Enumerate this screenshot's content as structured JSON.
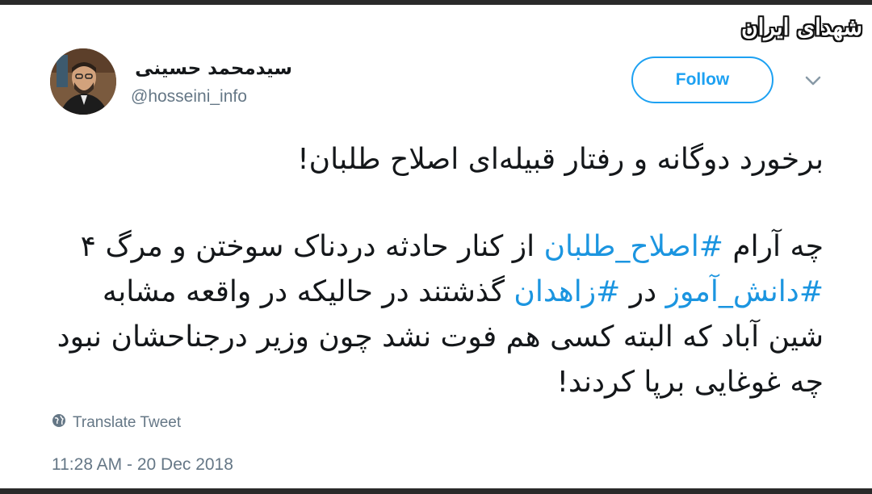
{
  "watermark": {
    "text": "شهدای ایران"
  },
  "author": {
    "name": "سیدمحمد حسینی",
    "handle": "@hosseini_info"
  },
  "actions": {
    "follow_label": "Follow"
  },
  "tweet": {
    "line1": "برخورد دوگانه و رفتار قبیله‌ای اصلاح طلبان!",
    "p2_a": "چه آرام ",
    "hashtag1": "#اصلاح_طلبان",
    "p2_b": " از کنار حادثه دردناک سوختن و مرگ ۴ ",
    "hashtag2": "#دانش_آموز",
    "p2_c": " در ",
    "hashtag3": "#زاهدان",
    "p2_d": " گذشتند در حالیکه در واقعه مشابه شین آباد که البته کسی هم فوت نشد چون وزیر درجناحشان نبود چه غوغایی برپا کردند!"
  },
  "translate_label": "Translate Tweet",
  "timestamp": "11:28 AM - 20 Dec 2018",
  "colors": {
    "accent": "#1da1f2",
    "hashtag": "#1b95e0",
    "muted": "#657786"
  },
  "icons": {
    "translate": "globe-icon",
    "menu": "chevron-down-icon"
  }
}
